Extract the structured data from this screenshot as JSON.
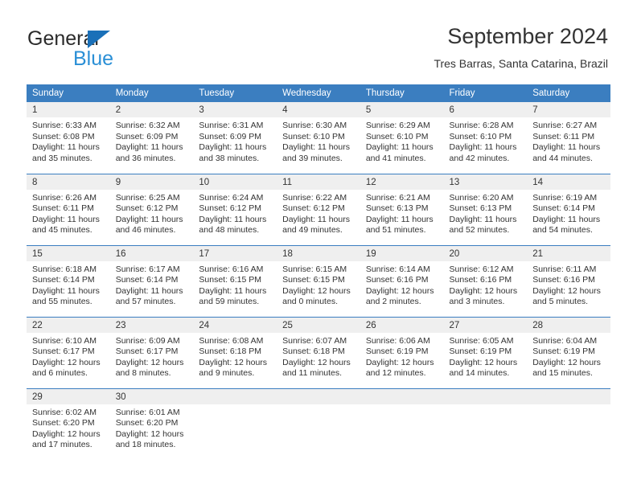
{
  "brand": {
    "name_part1": "General",
    "name_part2": "Blue",
    "triangle_color": "#1a70b8",
    "blue_text_color": "#2a8fd6"
  },
  "header": {
    "title": "September 2024",
    "subtitle": "Tres Barras, Santa Catarina, Brazil"
  },
  "theme": {
    "header_row_bg": "#3b7ec0",
    "header_row_text": "#ffffff",
    "daynum_band_bg": "#efefef",
    "row_separator": "#3b7ec0",
    "body_text": "#333333"
  },
  "weekdays": [
    "Sunday",
    "Monday",
    "Tuesday",
    "Wednesday",
    "Thursday",
    "Friday",
    "Saturday"
  ],
  "weeks": [
    [
      {
        "day": "1",
        "sunrise": "Sunrise: 6:33 AM",
        "sunset": "Sunset: 6:08 PM",
        "daylight": "Daylight: 11 hours and 35 minutes."
      },
      {
        "day": "2",
        "sunrise": "Sunrise: 6:32 AM",
        "sunset": "Sunset: 6:09 PM",
        "daylight": "Daylight: 11 hours and 36 minutes."
      },
      {
        "day": "3",
        "sunrise": "Sunrise: 6:31 AM",
        "sunset": "Sunset: 6:09 PM",
        "daylight": "Daylight: 11 hours and 38 minutes."
      },
      {
        "day": "4",
        "sunrise": "Sunrise: 6:30 AM",
        "sunset": "Sunset: 6:10 PM",
        "daylight": "Daylight: 11 hours and 39 minutes."
      },
      {
        "day": "5",
        "sunrise": "Sunrise: 6:29 AM",
        "sunset": "Sunset: 6:10 PM",
        "daylight": "Daylight: 11 hours and 41 minutes."
      },
      {
        "day": "6",
        "sunrise": "Sunrise: 6:28 AM",
        "sunset": "Sunset: 6:10 PM",
        "daylight": "Daylight: 11 hours and 42 minutes."
      },
      {
        "day": "7",
        "sunrise": "Sunrise: 6:27 AM",
        "sunset": "Sunset: 6:11 PM",
        "daylight": "Daylight: 11 hours and 44 minutes."
      }
    ],
    [
      {
        "day": "8",
        "sunrise": "Sunrise: 6:26 AM",
        "sunset": "Sunset: 6:11 PM",
        "daylight": "Daylight: 11 hours and 45 minutes."
      },
      {
        "day": "9",
        "sunrise": "Sunrise: 6:25 AM",
        "sunset": "Sunset: 6:12 PM",
        "daylight": "Daylight: 11 hours and 46 minutes."
      },
      {
        "day": "10",
        "sunrise": "Sunrise: 6:24 AM",
        "sunset": "Sunset: 6:12 PM",
        "daylight": "Daylight: 11 hours and 48 minutes."
      },
      {
        "day": "11",
        "sunrise": "Sunrise: 6:22 AM",
        "sunset": "Sunset: 6:12 PM",
        "daylight": "Daylight: 11 hours and 49 minutes."
      },
      {
        "day": "12",
        "sunrise": "Sunrise: 6:21 AM",
        "sunset": "Sunset: 6:13 PM",
        "daylight": "Daylight: 11 hours and 51 minutes."
      },
      {
        "day": "13",
        "sunrise": "Sunrise: 6:20 AM",
        "sunset": "Sunset: 6:13 PM",
        "daylight": "Daylight: 11 hours and 52 minutes."
      },
      {
        "day": "14",
        "sunrise": "Sunrise: 6:19 AM",
        "sunset": "Sunset: 6:14 PM",
        "daylight": "Daylight: 11 hours and 54 minutes."
      }
    ],
    [
      {
        "day": "15",
        "sunrise": "Sunrise: 6:18 AM",
        "sunset": "Sunset: 6:14 PM",
        "daylight": "Daylight: 11 hours and 55 minutes."
      },
      {
        "day": "16",
        "sunrise": "Sunrise: 6:17 AM",
        "sunset": "Sunset: 6:14 PM",
        "daylight": "Daylight: 11 hours and 57 minutes."
      },
      {
        "day": "17",
        "sunrise": "Sunrise: 6:16 AM",
        "sunset": "Sunset: 6:15 PM",
        "daylight": "Daylight: 11 hours and 59 minutes."
      },
      {
        "day": "18",
        "sunrise": "Sunrise: 6:15 AM",
        "sunset": "Sunset: 6:15 PM",
        "daylight": "Daylight: 12 hours and 0 minutes."
      },
      {
        "day": "19",
        "sunrise": "Sunrise: 6:14 AM",
        "sunset": "Sunset: 6:16 PM",
        "daylight": "Daylight: 12 hours and 2 minutes."
      },
      {
        "day": "20",
        "sunrise": "Sunrise: 6:12 AM",
        "sunset": "Sunset: 6:16 PM",
        "daylight": "Daylight: 12 hours and 3 minutes."
      },
      {
        "day": "21",
        "sunrise": "Sunrise: 6:11 AM",
        "sunset": "Sunset: 6:16 PM",
        "daylight": "Daylight: 12 hours and 5 minutes."
      }
    ],
    [
      {
        "day": "22",
        "sunrise": "Sunrise: 6:10 AM",
        "sunset": "Sunset: 6:17 PM",
        "daylight": "Daylight: 12 hours and 6 minutes."
      },
      {
        "day": "23",
        "sunrise": "Sunrise: 6:09 AM",
        "sunset": "Sunset: 6:17 PM",
        "daylight": "Daylight: 12 hours and 8 minutes."
      },
      {
        "day": "24",
        "sunrise": "Sunrise: 6:08 AM",
        "sunset": "Sunset: 6:18 PM",
        "daylight": "Daylight: 12 hours and 9 minutes."
      },
      {
        "day": "25",
        "sunrise": "Sunrise: 6:07 AM",
        "sunset": "Sunset: 6:18 PM",
        "daylight": "Daylight: 12 hours and 11 minutes."
      },
      {
        "day": "26",
        "sunrise": "Sunrise: 6:06 AM",
        "sunset": "Sunset: 6:19 PM",
        "daylight": "Daylight: 12 hours and 12 minutes."
      },
      {
        "day": "27",
        "sunrise": "Sunrise: 6:05 AM",
        "sunset": "Sunset: 6:19 PM",
        "daylight": "Daylight: 12 hours and 14 minutes."
      },
      {
        "day": "28",
        "sunrise": "Sunrise: 6:04 AM",
        "sunset": "Sunset: 6:19 PM",
        "daylight": "Daylight: 12 hours and 15 minutes."
      }
    ],
    [
      {
        "day": "29",
        "sunrise": "Sunrise: 6:02 AM",
        "sunset": "Sunset: 6:20 PM",
        "daylight": "Daylight: 12 hours and 17 minutes."
      },
      {
        "day": "30",
        "sunrise": "Sunrise: 6:01 AM",
        "sunset": "Sunset: 6:20 PM",
        "daylight": "Daylight: 12 hours and 18 minutes."
      },
      {
        "day": "",
        "sunrise": "",
        "sunset": "",
        "daylight": ""
      },
      {
        "day": "",
        "sunrise": "",
        "sunset": "",
        "daylight": ""
      },
      {
        "day": "",
        "sunrise": "",
        "sunset": "",
        "daylight": ""
      },
      {
        "day": "",
        "sunrise": "",
        "sunset": "",
        "daylight": ""
      },
      {
        "day": "",
        "sunrise": "",
        "sunset": "",
        "daylight": ""
      }
    ]
  ]
}
